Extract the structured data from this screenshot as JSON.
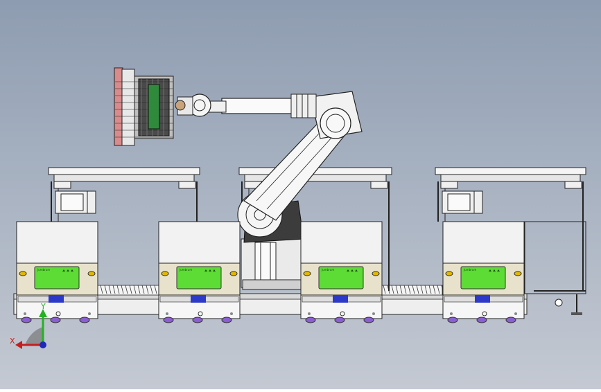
{
  "screen_label": "Jumbrum",
  "triad": {
    "x_label": "X",
    "y_label": "Y"
  },
  "colors": {
    "background_top": "#8e9cb1",
    "background_bottom": "#c4c9d2",
    "screen_green": "#5ddc35",
    "blue_label": "#2d39c9",
    "frame_line": "#222222",
    "panel_white": "#f2f2f2"
  },
  "stations": [
    {
      "id": "station-1"
    },
    {
      "id": "station-2"
    },
    {
      "id": "station-3"
    },
    {
      "id": "station-4"
    }
  ]
}
